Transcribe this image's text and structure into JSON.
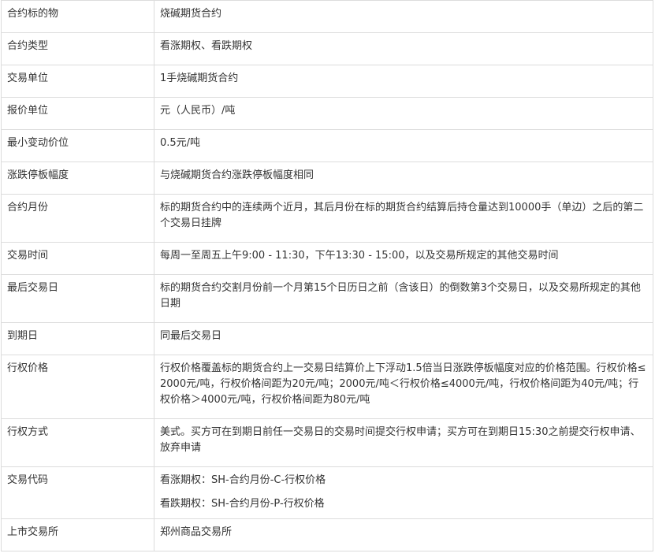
{
  "rows": [
    {
      "label": "合约标的物",
      "value": [
        "烧碱期货合约"
      ]
    },
    {
      "label": "合约类型",
      "value": [
        "看涨期权、看跌期权"
      ]
    },
    {
      "label": "交易单位",
      "value": [
        "1手烧碱期货合约"
      ]
    },
    {
      "label": "报价单位",
      "value": [
        "元（人民币）/吨"
      ]
    },
    {
      "label": "最小变动价位",
      "value": [
        "0.5元/吨"
      ]
    },
    {
      "label": "涨跌停板幅度",
      "value": [
        "与烧碱期货合约涨跌停板幅度相同"
      ]
    },
    {
      "label": "合约月份",
      "value": [
        "标的期货合约中的连续两个近月，其后月份在标的期货合约结算后持仓量达到10000手（单边）之后的第二个交易日挂牌"
      ]
    },
    {
      "label": "交易时间",
      "value": [
        "每周一至周五上午9:00 - 11:30，下午13:30 - 15:00，以及交易所规定的其他交易时间"
      ]
    },
    {
      "label": "最后交易日",
      "value": [
        "标的期货合约交割月份前一个月第15个日历日之前（含该日）的倒数第3个交易日，以及交易所规定的其他日期"
      ]
    },
    {
      "label": "到期日",
      "value": [
        "同最后交易日"
      ]
    },
    {
      "label": "行权价格",
      "value": [
        "行权价格覆盖标的期货合约上一交易日结算价上下浮动1.5倍当日涨跌停板幅度对应的价格范围。行权价格≤2000元/吨，行权价格间距为20元/吨；2000元/吨＜行权价格≤4000元/吨，行权价格间距为40元/吨；行权价格＞4000元/吨，行权价格间距为80元/吨"
      ]
    },
    {
      "label": "行权方式",
      "value": [
        "美式。买方可在到期日前任一交易日的交易时间提交行权申请；买方可在到期日15:30之前提交行权申请、放弃申请"
      ]
    },
    {
      "label": "交易代码",
      "value": [
        "看涨期权：SH-合约月份-C-行权价格",
        "看跌期权：SH-合约月份-P-行权价格"
      ]
    },
    {
      "label": "上市交易所",
      "value": [
        "郑州商品交易所"
      ]
    }
  ]
}
